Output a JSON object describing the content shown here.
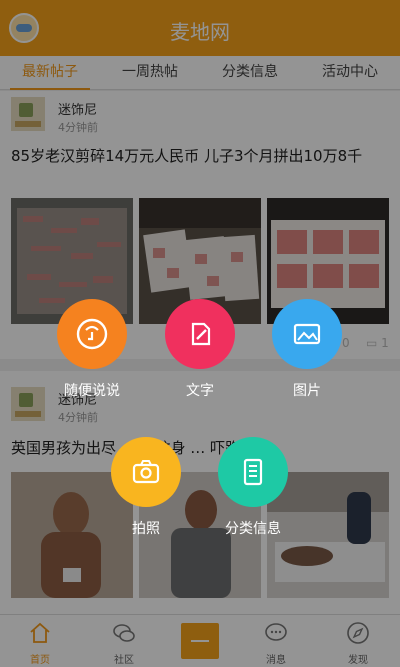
{
  "app": {
    "title": "麦地网"
  },
  "tabs": [
    {
      "label": "最新帖子",
      "active": true
    },
    {
      "label": "一周热帖",
      "active": false
    },
    {
      "label": "分类信息",
      "active": false
    },
    {
      "label": "活动中心",
      "active": false
    }
  ],
  "posts": [
    {
      "author": "迷饰尼",
      "time": "4分钟前",
      "title": "85岁老汉剪碎14万元人民币 儿子3个月拼出10万8千",
      "comments": "0",
      "likes": "1"
    },
    {
      "author": "迷饰尼",
      "time": "4分钟前",
      "title": "英国男孩为出尽 … 部纹身 … 吓跑"
    }
  ],
  "menu": {
    "random_talk": "随便说说",
    "text": "文字",
    "image": "图片",
    "photo": "拍照",
    "classified": "分类信息"
  },
  "nav": {
    "home": "首页",
    "community": "社区",
    "messages": "消息",
    "discover": "发现"
  },
  "colors": {
    "brand": "#f6a31a",
    "menu_random_talk": "#f5821f",
    "menu_text": "#f0305e",
    "menu_image": "#39a8ee",
    "menu_photo": "#f9b51f",
    "menu_classified": "#1ec9a5"
  }
}
